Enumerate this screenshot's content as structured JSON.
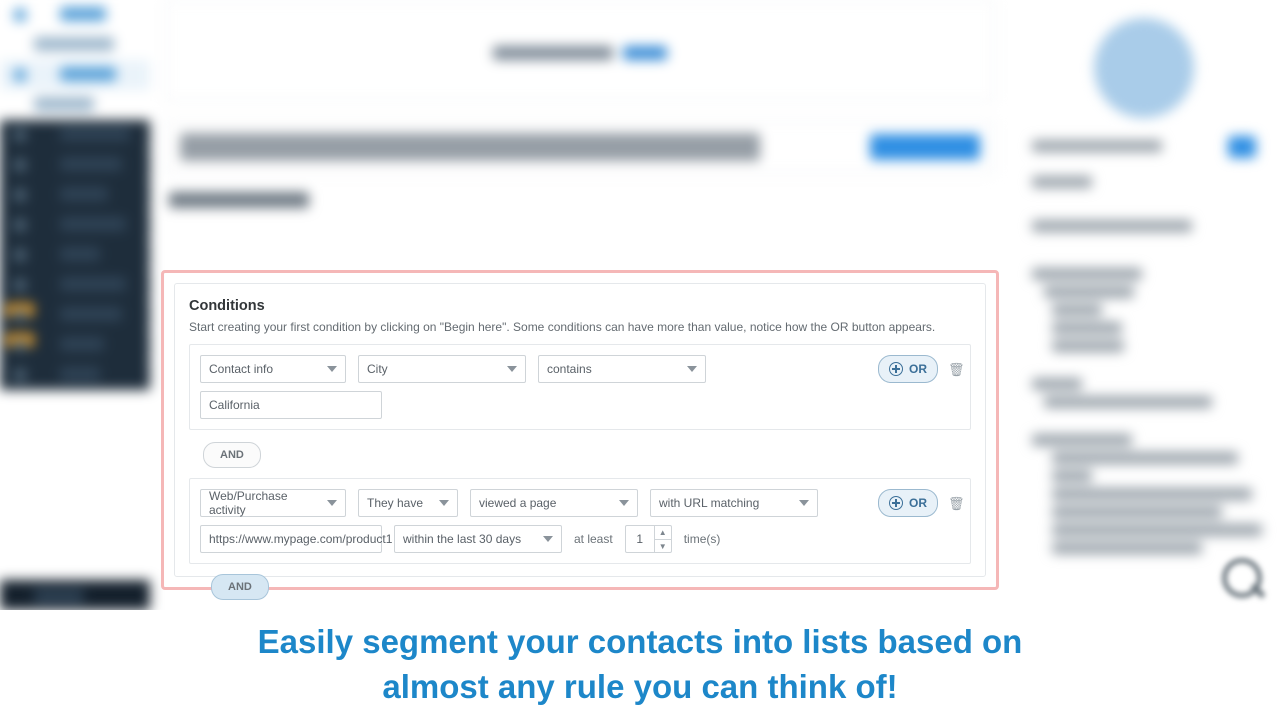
{
  "conditions": {
    "title": "Conditions",
    "subtitle": "Start creating your first condition by clicking on \"Begin here\". Some conditions can have more than value, notice how the OR button appears.",
    "or_label": "OR",
    "and_label": "AND",
    "rule1": {
      "category": "Contact info",
      "field": "City",
      "operator": "contains",
      "value": "California"
    },
    "rule2": {
      "category": "Web/Purchase activity",
      "actor": "They have",
      "action": "viewed a page",
      "match": "with URL matching",
      "url": "https://www.mypage.com/product1",
      "timeframe": "within the last 30 days",
      "at_least_label": "at least",
      "count": "1",
      "times_label": "time(s)"
    }
  },
  "caption": {
    "line1": "Easily segment your contacts into lists based on",
    "line2": "almost any rule you can think of!"
  }
}
